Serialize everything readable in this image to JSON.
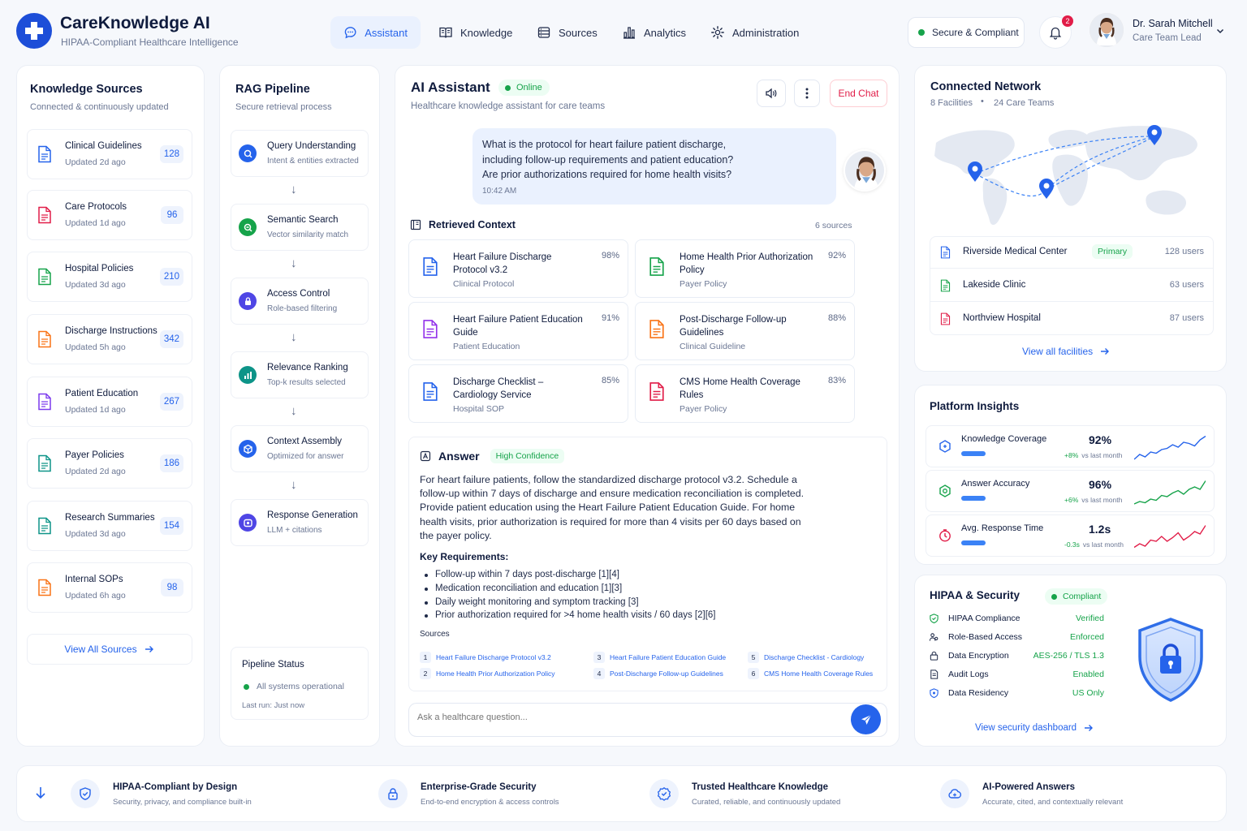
{
  "app": {
    "name": "CareKnowledge AI",
    "tagline": "HIPAA-Compliant Healthcare Intelligence"
  },
  "nav": [
    {
      "label": "Assistant",
      "icon": "chat-icon"
    },
    {
      "label": "Knowledge",
      "icon": "book-icon"
    },
    {
      "label": "Sources",
      "icon": "database-icon"
    },
    {
      "label": "Analytics",
      "icon": "bar-chart-icon"
    },
    {
      "label": "Administration",
      "icon": "gear-icon"
    }
  ],
  "header": {
    "secure_badge": "Secure & Compliant",
    "notification_count": "2",
    "user_name": "Dr. Sarah Mitchell",
    "user_role": "Care Team Lead"
  },
  "sources": {
    "title": "Knowledge Sources",
    "subtitle": "Connected & continuously updated",
    "items": [
      {
        "name": "Clinical Guidelines",
        "updated": "Updated 2d ago",
        "count": "128",
        "color": "#2563eb"
      },
      {
        "name": "Care Protocols",
        "updated": "Updated 1d ago",
        "count": "96",
        "color": "#e11d48"
      },
      {
        "name": "Hospital Policies",
        "updated": "Updated 3d ago",
        "count": "210",
        "color": "#16a34a"
      },
      {
        "name": "Discharge Instructions",
        "updated": "Updated 5h ago",
        "count": "342",
        "color": "#f97316"
      },
      {
        "name": "Patient Education",
        "updated": "Updated 1d ago",
        "count": "267",
        "color": "#7c3aed"
      },
      {
        "name": "Payer Policies",
        "updated": "Updated 2d ago",
        "count": "186",
        "color": "#0d9488"
      },
      {
        "name": "Research Summaries",
        "updated": "Updated 3d ago",
        "count": "154",
        "color": "#0d9488"
      },
      {
        "name": "Internal SOPs",
        "updated": "Updated 6h ago",
        "count": "98",
        "color": "#f97316"
      }
    ],
    "view_all": "View All Sources"
  },
  "pipeline": {
    "title": "RAG Pipeline",
    "subtitle": "Secure retrieval process",
    "steps": [
      {
        "name": "Query Understanding",
        "desc": "Intent & entities extracted",
        "color": "#2563eb"
      },
      {
        "name": "Semantic Search",
        "desc": "Vector similarity match",
        "color": "#16a34a"
      },
      {
        "name": "Access Control",
        "desc": "Role-based filtering",
        "color": "#4f46e5"
      },
      {
        "name": "Relevance Ranking",
        "desc": "Top-k results selected",
        "color": "#0d9488"
      },
      {
        "name": "Context Assembly",
        "desc": "Optimized for answer",
        "color": "#2563eb"
      },
      {
        "name": "Response Generation",
        "desc": "LLM + citations",
        "color": "#4f46e5"
      }
    ],
    "arrow": "↓",
    "status_title": "Pipeline Status",
    "status_text": "All systems operational",
    "last_run": "Last run: Just now"
  },
  "assistant": {
    "title": "AI Assistant",
    "status": "Online",
    "subtitle": "Healthcare knowledge assistant for care teams",
    "end_chat": "End Chat",
    "question": "What is the protocol for heart failure patient discharge, including follow-up requirements and patient education? Are prior authorizations required for home health visits?",
    "question_time": "10:42 AM",
    "context_title": "Retrieved Context",
    "context_count": "6 sources",
    "context": [
      {
        "title": "Heart Failure Discharge Protocol v3.2",
        "type": "Clinical Protocol",
        "score": "98%",
        "color": "#2563eb"
      },
      {
        "title": "Home Health Prior Authorization Policy",
        "type": "Payer Policy",
        "score": "92%",
        "color": "#16a34a"
      },
      {
        "title": "Heart Failure Patient Education Guide",
        "type": "Patient Education",
        "score": "91%",
        "color": "#9333ea"
      },
      {
        "title": "Post-Discharge Follow-up Guidelines",
        "type": "Clinical Guideline",
        "score": "88%",
        "color": "#f97316"
      },
      {
        "title": "Discharge Checklist – Cardiology Service",
        "type": "Hospital SOP",
        "score": "85%",
        "color": "#2563eb"
      },
      {
        "title": "CMS Home Health Coverage Rules",
        "type": "Payer Policy",
        "score": "83%",
        "color": "#e11d48"
      }
    ],
    "answer_title": "Answer",
    "confidence": "High Confidence",
    "answer": "For heart failure patients, follow the standardized discharge protocol v3.2. Schedule a follow-up within 7 days of discharge and ensure medication reconciliation is completed. Provide patient education using the Heart Failure Patient Education Guide. For home health visits, prior authorization is required for more than 4 visits per 60 days based on the payer policy.",
    "requirements_title": "Key Requirements:",
    "requirements": [
      "Follow-up within 7 days post-discharge [1][4]",
      "Medication reconciliation and education [1][3]",
      "Daily weight monitoring and symptom tracking [3]",
      "Prior authorization required for >4 home health visits / 60 days [2][6]"
    ],
    "sources_label": "Sources",
    "sources": [
      {
        "n": "1",
        "label": "Heart Failure Discharge Protocol v3.2"
      },
      {
        "n": "2",
        "label": "Home Health Prior Authorization Policy"
      },
      {
        "n": "3",
        "label": "Heart Failure Patient Education Guide"
      },
      {
        "n": "4",
        "label": "Post-Discharge Follow-up Guidelines"
      },
      {
        "n": "5",
        "label": "Discharge Checklist - Cardiology"
      },
      {
        "n": "6",
        "label": "CMS Home Health Coverage Rules"
      }
    ],
    "input_placeholder": "Ask a healthcare question..."
  },
  "network": {
    "title": "Connected Network",
    "facilities": "8 Facilities",
    "teams": "24 Care Teams",
    "items": [
      {
        "name": "Riverside Medical Center",
        "badge": "Primary",
        "users": "128 users",
        "color": "#2563eb"
      },
      {
        "name": "Lakeside Clinic",
        "badge": "",
        "users": "63 users",
        "color": "#16a34a"
      },
      {
        "name": "Northview Hospital",
        "badge": "",
        "users": "87 users",
        "color": "#e11d48"
      }
    ],
    "view_all": "View all facilities"
  },
  "insights": {
    "title": "Platform Insights",
    "items": [
      {
        "name": "Knowledge Coverage",
        "value": "92%",
        "delta": "+8%",
        "delta_suffix": "vs last month",
        "color": "#2563eb"
      },
      {
        "name": "Answer Accuracy",
        "value": "96%",
        "delta": "+6%",
        "delta_suffix": "vs last month",
        "color": "#16a34a"
      },
      {
        "name": "Avg. Response Time",
        "value": "1.2s",
        "delta": "-0.3s",
        "delta_suffix": "vs last month",
        "color": "#e11d48"
      }
    ]
  },
  "hipaa": {
    "title": "HIPAA & Security",
    "status": "Compliant",
    "rows": [
      {
        "label": "HIPAA Compliance",
        "value": "Verified"
      },
      {
        "label": "Role-Based Access",
        "value": "Enforced"
      },
      {
        "label": "Data Encryption",
        "value": "AES-256 / TLS 1.3"
      },
      {
        "label": "Audit Logs",
        "value": "Enabled"
      },
      {
        "label": "Data Residency",
        "value": "US Only"
      }
    ],
    "view": "View security dashboard"
  },
  "footer": [
    {
      "title": "HIPAA-Compliant by Design",
      "desc": "Security, privacy, and compliance built-in"
    },
    {
      "title": "Enterprise-Grade Security",
      "desc": "End-to-end encryption & access controls"
    },
    {
      "title": "Trusted Healthcare Knowledge",
      "desc": "Curated, reliable, and continuously updated"
    },
    {
      "title": "AI-Powered Answers",
      "desc": "Accurate, cited, and contextually relevant"
    }
  ],
  "colors": {
    "accent": "#2563eb",
    "success": "#16a34a",
    "danger": "#e11d48"
  }
}
